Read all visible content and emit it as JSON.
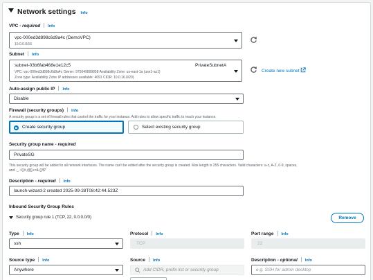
{
  "section": {
    "title": "Network settings",
    "info": "Info"
  },
  "vpc": {
    "label": "VPC",
    "required": "- required",
    "info": "Info",
    "value": "vpc-000ed3d898c6d9a4c (DemoVPC)",
    "cidr": "10.0.0.0/16"
  },
  "subnet": {
    "label": "Subnet",
    "info": "Info",
    "id": "subnet-03b6fab468e1e12c5",
    "name": "PrivateSubnetA",
    "line1": "VPC: vpc-000ed3d898c6d9a4c    Owner: 975049899858    Availability Zone: us-east-1a (use1-az1)",
    "line2": "Zone type: Availability Zone    IP addresses available: 4091    CIDR: 10.0.16.0/20)",
    "create_link": "Create new subnet"
  },
  "auto_assign": {
    "label": "Auto-assign public IP",
    "info": "Info",
    "value": "Disable"
  },
  "firewall": {
    "label": "Firewall (security groups)",
    "info": "Info",
    "description": "A security group is a set of firewall rules that control the traffic for your instance. Add rules to allow specific traffic to reach your instance.",
    "option_create": "Create security group",
    "option_existing": "Select existing security group"
  },
  "sg_name": {
    "label": "Security group name",
    "required": "- required",
    "value": "PrivateSG",
    "help1": "This security group will be added to all network interfaces. The name can't be edited after the security group is created. Max length is 255 characters. Valid characters: a-z, A-Z, 0-9, spaces,",
    "help2": "and ._-:/()#,@[]+=&;{}!$*"
  },
  "description": {
    "label": "Description",
    "required": "- required",
    "info": "Info",
    "value": "launch-wizard-2 created 2025-09-28T08:42:44.523Z"
  },
  "inbound": {
    "title": "Inbound Security Group Rules",
    "rule_title": "Security group rule 1 (TCP, 22, 0.0.0.0/0)",
    "remove": "Remove",
    "type_label": "Type",
    "type_info": "Info",
    "type_value": "ssh",
    "protocol_label": "Protocol",
    "protocol_info": "Info",
    "protocol_value": "TCP",
    "port_label": "Port range",
    "port_info": "Info",
    "port_value": "22",
    "source_type_label": "Source type",
    "source_type_info": "Info",
    "source_type_value": "Anywhere",
    "source_label": "Source",
    "source_info": "Info",
    "source_placeholder": "Add CIDR, prefix list or security group",
    "desc_label": "Description",
    "desc_optional": "- optional",
    "desc_info": "Info",
    "desc_placeholder": "e.g. SSH for admin desktop"
  },
  "colors": {
    "accent": "#0073bb",
    "border": "#687078",
    "text": "#16191f"
  }
}
